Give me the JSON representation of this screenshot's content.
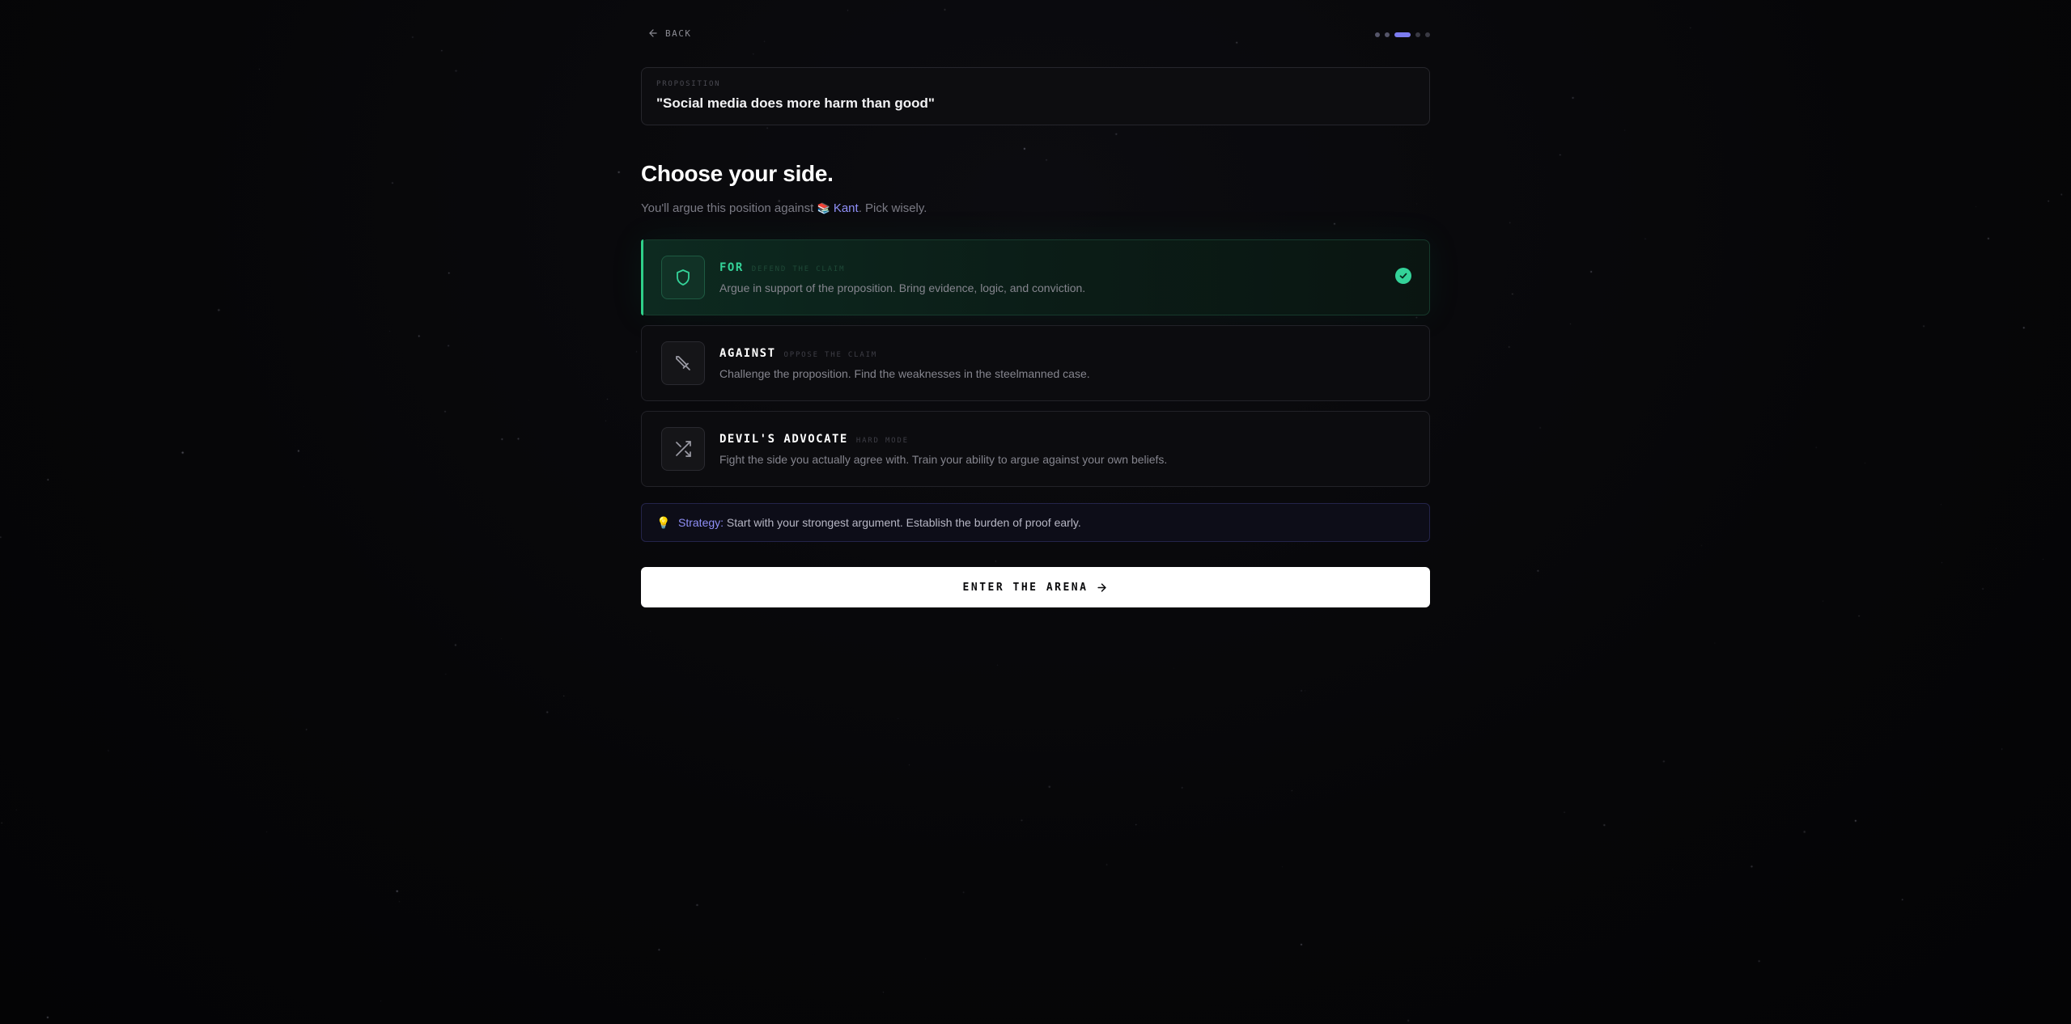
{
  "nav": {
    "back_label": "BACK",
    "steps": [
      "done",
      "done",
      "active",
      "todo",
      "todo"
    ]
  },
  "proposition": {
    "label": "PROPOSITION",
    "text": "\"Social media does more harm than good\""
  },
  "heading": "Choose your side.",
  "subtitle": {
    "prefix": "You'll argue this position against ",
    "opponent_icon": "📚",
    "opponent": "Kant",
    "suffix": ". Pick wisely."
  },
  "sides": [
    {
      "name": "FOR",
      "tag": "DEFEND THE CLAIM",
      "description": "Argue in support of the proposition. Bring evidence, logic, and conviction.",
      "icon": "shield-icon",
      "selected": true
    },
    {
      "name": "AGAINST",
      "tag": "OPPOSE THE CLAIM",
      "description": "Challenge the proposition. Find the weaknesses in the steelmanned case.",
      "icon": "sword-icon",
      "selected": false
    },
    {
      "name": "DEVIL'S ADVOCATE",
      "tag": "HARD MODE",
      "description": "Fight the side you actually agree with. Train your ability to argue against your own beliefs.",
      "icon": "shuffle-icon",
      "selected": false
    }
  ],
  "strategy": {
    "icon": "💡",
    "label": "Strategy:",
    "text": " Start with your strongest argument. Establish the burden of proof early."
  },
  "enter_button": {
    "label": "ENTER THE ARENA"
  },
  "colors": {
    "accent_green": "#34d399",
    "accent_purple": "#8f8ff7",
    "background": "#060608"
  }
}
